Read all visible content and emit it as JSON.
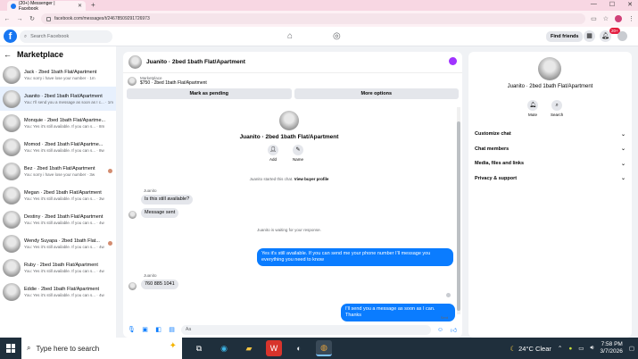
{
  "browser": {
    "tab_title": "(20+) Messenger | Facebook",
    "tab_close": "✕",
    "new_tab": "+",
    "url": "facebook.com/messages/t/24678509291726973",
    "nav_back": "←",
    "nav_forward": "→",
    "reload": "↻",
    "window_controls": [
      "—",
      "☐",
      "✕"
    ]
  },
  "fb": {
    "logo": "f",
    "search_placeholder": "Search Facebook",
    "find_friends": "Find friends",
    "notifications_badge": "20+"
  },
  "sidebar": {
    "title": "Marketplace",
    "back": "←",
    "items": [
      {
        "name": "Jack · 2bed 1bath Flat/Apartment",
        "preview": "You: sorry i have lose your number · 1m",
        "dot": false
      },
      {
        "name": "Juanito · 2bed 1bath Flat/Apartment",
        "preview": "You: I'll send you a message as soon as I c... · 1m",
        "dot": false
      },
      {
        "name": "Monquie · 2bed 1bath Flat/Apartme...",
        "preview": "You: Yes it's still available. If you can s... · 8m",
        "dot": false
      },
      {
        "name": "Momod · 2bed 1bath Flat/Apartme...",
        "preview": "You: Yes it's still available. If you can s... · 8w",
        "dot": false
      },
      {
        "name": "Bez · 2bed 1bath Flat/Apartment",
        "preview": "You: sorry i have lose your number · 3w",
        "dot": true
      },
      {
        "name": "Megan · 2bed 1bath Flat/Apartment",
        "preview": "You: Yes it's still available. If you can s... · 3w",
        "dot": false
      },
      {
        "name": "Destiny · 2bed 1bath Flat/Apartment",
        "preview": "You: Yes it's still available. If you can s... · 4w",
        "dot": false
      },
      {
        "name": "Wendy Suyapa · 2bed 1bath Flat...",
        "preview": "You: Yes it's still available. If you can s... · 4w",
        "dot": true
      },
      {
        "name": "Ruby · 2bed 1bath Flat/Apartment",
        "preview": "You: Yes it's still available. If you can s... · 4w",
        "dot": false
      },
      {
        "name": "Eddie · 2bed 1bath Flat/Apartment",
        "preview": "You: Yes it's still available. If you can s... · 4w",
        "dot": false
      }
    ]
  },
  "chat": {
    "header_name": "Juanito · 2bed 1bath Flat/Apartment",
    "listing_source": "Marketplace",
    "listing_info": "$750 · 2bed 1bath Flat/Apartment",
    "mark_pending": "Mark as pending",
    "more_options": "More options",
    "hero_title": "Juanito · 2bed 1bath Flat/Apartment",
    "hero_add": "Add",
    "hero_name": "Name",
    "started_prefix": "Juanito started this chat.",
    "view_profile": "View buyer profile",
    "sender1": "Juanito",
    "msg_in_1": "Is this still available?",
    "msg_in_2": "Message sent",
    "waiting": "Juanito is waiting for your response.",
    "msg_out_1": "Yes it's still available. If you can send me your phone number I'll message you everything you need to know",
    "sender2": "Juanito",
    "msg_in_3": "760 885 1041",
    "msg_out_2": "I'll send you a message as soon as I can. Thanks",
    "seen": "Sent",
    "composer_placeholder": "Aa"
  },
  "rpanel": {
    "title": "Juanito · 2bed 1bath Flat/Apartment",
    "mute": "Mute",
    "search": "Search",
    "sections": [
      "Customize chat",
      "Chat members",
      "Media, files and links",
      "Privacy & support"
    ]
  },
  "taskbar": {
    "search_placeholder": "Type here to search",
    "weather": "24°C  Clear",
    "time": "7:58 PM",
    "date": "3/7/2026"
  }
}
